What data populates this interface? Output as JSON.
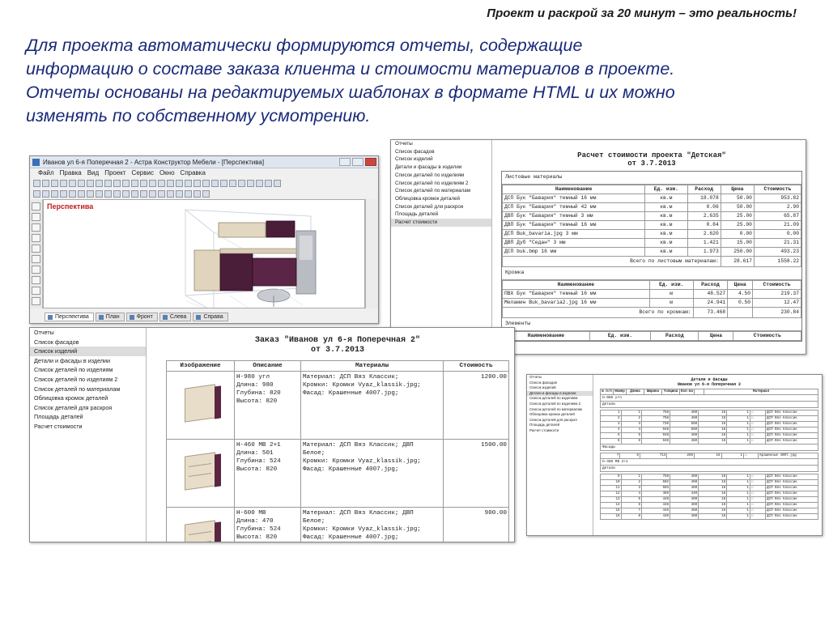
{
  "slide": {
    "header": "Проект и раскрой за 20 минут – это реальность!",
    "body_lines": [
      "Для проекта автоматически формируются отчеты, содержащие",
      "информацию о составе заказа клиента и стоимости материалов в проекте.",
      "Отчеты основаны на редактируемых шаблонах в формате HTML и их можно",
      "изменять по собственному усмотрению."
    ]
  },
  "app_window": {
    "title": "Иванов ул 6-я Поперечная 2 - Астра Конструктор Мебели - [Перспектива]",
    "menu": [
      "Файл",
      "Правка",
      "Вид",
      "Проект",
      "Сервис",
      "Окно",
      "Справка"
    ],
    "viewport_label": "Перспектива",
    "tabs": [
      "Перспектива",
      "План",
      "Фронт",
      "Слева",
      "Справа"
    ],
    "active_tab": "Перспектива"
  },
  "report_list": {
    "items": [
      "Отчеты",
      "Список фасадов",
      "Список изделий",
      "Детали и фасады в изделии",
      "Список деталей по изделиям",
      "Список деталей по изделиям 2",
      "Список деталей по материалам",
      "Облицовка кромок деталей",
      "Список деталей для раскроя",
      "Площадь деталей",
      "Расчет стоимости"
    ]
  },
  "cost_report": {
    "selected": "Расчет стоимости",
    "title": "Расчет стоимости проекта \"Детская\"",
    "date": "от 3.7.2013",
    "sheet_section": "Листовые материалы",
    "columns": [
      "Наименование",
      "Ед. изм.",
      "Расход",
      "Цена",
      "Стоимость"
    ],
    "sheet_rows": [
      [
        "ДСП Бук \"Бавария\" темный 16 мм",
        "кв.м",
        "18.078",
        "50.00",
        "953.82"
      ],
      [
        "ДСП Бук \"Бавария\" темный 42 мм",
        "кв.м",
        "0.06",
        "50.00",
        "2.90"
      ],
      [
        "ДВП Бук \"Бавария\" темный 3 мм",
        "кв.м",
        "2.635",
        "25.00",
        "65.87"
      ],
      [
        "ДВП Бук \"Бавария\" темный 16 мм",
        "кв.м",
        "0.84",
        "25.00",
        "21.09"
      ],
      [
        "ДСП Buk_bavaria.jpg 3 мм",
        "кв.м",
        "2.620",
        "0.00",
        "0.00"
      ],
      [
        "ДВП Дуб \"Седан\" 3 мм",
        "кв.м",
        "1.421",
        "15.00",
        "21.31"
      ],
      [
        "ДСП buk.bmp 16 мм",
        "кв.м",
        "1.973",
        "250.00",
        "493.23"
      ]
    ],
    "sheet_total_label": "Всего по листовым материалам:",
    "sheet_total_qty": "28.617",
    "sheet_total_cost": "1558.22",
    "edge_section": "Кромка",
    "edge_rows": [
      [
        "ПВХ Бук \"Бавария\" темный 16 мм",
        "м",
        "48.527",
        "4.50",
        "219.37"
      ],
      [
        "Меламин Buk_bavaria2.jpg 16 мм",
        "м",
        "24.941",
        "0.50",
        "12.47"
      ]
    ],
    "edge_total_label": "Всего по кромкам:",
    "edge_total_qty": "73.468",
    "edge_total_cost": "230.84",
    "elements_section": "Элементы"
  },
  "order_report": {
    "selected": "Список изделий",
    "title": "Заказ \"Иванов ул 6-я Поперечная 2\"",
    "date": "от 3.7.2013",
    "columns": [
      "Изображение",
      "Описание",
      "Материалы",
      "Стоимость"
    ],
    "rows": [
      {
        "desc": [
          "Н-980 угл",
          "Длина: 980",
          "Глубина: 820",
          "Высота: 820"
        ],
        "materials": [
          "Материал: ДСП Вяз Классик;",
          "Кромки: Кромки Vyaz_klassik.jpg;",
          "Фасад: Крашенные 4007.jpg;"
        ],
        "cost": "1200.00"
      },
      {
        "desc": [
          "Н-460 МВ 2+1",
          "Длина: 501",
          "Глубина: 524",
          "Высота: 820"
        ],
        "materials": [
          "Материал: ДСП Вяз Классик; ДВП",
          "Белое;",
          "Кромки: Кромки Vyaz_klassik.jpg;",
          "Фасад: Крашенные 4007.jpg;"
        ],
        "cost": "1500.00"
      },
      {
        "desc": [
          "Н-600 МВ",
          "Длина: 470",
          "Глубина: 524",
          "Высота: 820"
        ],
        "materials": [
          "Материал: ДСП Вяз Классик; ДВП",
          "Белое;",
          "Кромки: Кромки Vyaz_klassik.jpg;",
          "Фасад: Крашенные 4007.jpg;"
        ],
        "cost": "900.00"
      }
    ]
  },
  "parts_report": {
    "selected": "Детали и фасады в изделии",
    "title_line1": "Детали и фасады",
    "title_line2": "Иванов ул 6-я Поперечная 2",
    "columns": [
      "№ п/п",
      "Номер",
      "Длина",
      "Ширина",
      "Толщина",
      "Кол-во",
      "",
      "Материал"
    ],
    "group1": "Н-980 угл",
    "group1_sub1": "Детали",
    "group1_rows": [
      [
        "1",
        "1",
        "758",
        "460",
        "16",
        "1",
        "ДСП Вяз Классик"
      ],
      [
        "2",
        "2",
        "758",
        "460",
        "16",
        "1",
        "ДСП Вяз Классик"
      ],
      [
        "3",
        "3",
        "720",
        "560",
        "16",
        "1",
        "ДСП Вяз Классик"
      ],
      [
        "4",
        "4",
        "948",
        "560",
        "16",
        "1",
        "ДСП Вяз Классик"
      ],
      [
        "5",
        "5",
        "948",
        "460",
        "16",
        "1",
        "ДСП Вяз Классик"
      ],
      [
        "6",
        "6",
        "948",
        "460",
        "16",
        "1",
        "ДСП Вяз Классик"
      ]
    ],
    "group1_sub2": "Фасады",
    "group1_facade_rows": [
      [
        "7",
        "8",
        "713",
        "296",
        "16",
        "1",
        "Крашенные 4007.jpg"
      ]
    ],
    "group2": "Н-460 МВ 2+1",
    "group2_sub1": "Детали",
    "group2_rows": [
      [
        "9",
        "1",
        "758",
        "460",
        "16",
        "1",
        "ДСП Вяз Классик"
      ],
      [
        "10",
        "2",
        "502",
        "460",
        "16",
        "1",
        "ДСП Вяз Классик"
      ],
      [
        "11",
        "3",
        "503",
        "460",
        "16",
        "1",
        "ДСП Вяз Классик"
      ],
      [
        "12",
        "4",
        "469",
        "440",
        "16",
        "1",
        "ДСП Вяз Классик"
      ],
      [
        "13",
        "5",
        "448",
        "460",
        "16",
        "1",
        "ДСП Вяз Классик"
      ],
      [
        "14",
        "6",
        "448",
        "460",
        "16",
        "1",
        "ДСП Вяз Классик"
      ],
      [
        "15",
        "7",
        "446",
        "460",
        "16",
        "1",
        "ДСП Вяз Классик"
      ],
      [
        "16",
        "8",
        "440",
        "460",
        "16",
        "1",
        "ДСП Вяз Классик"
      ]
    ]
  }
}
